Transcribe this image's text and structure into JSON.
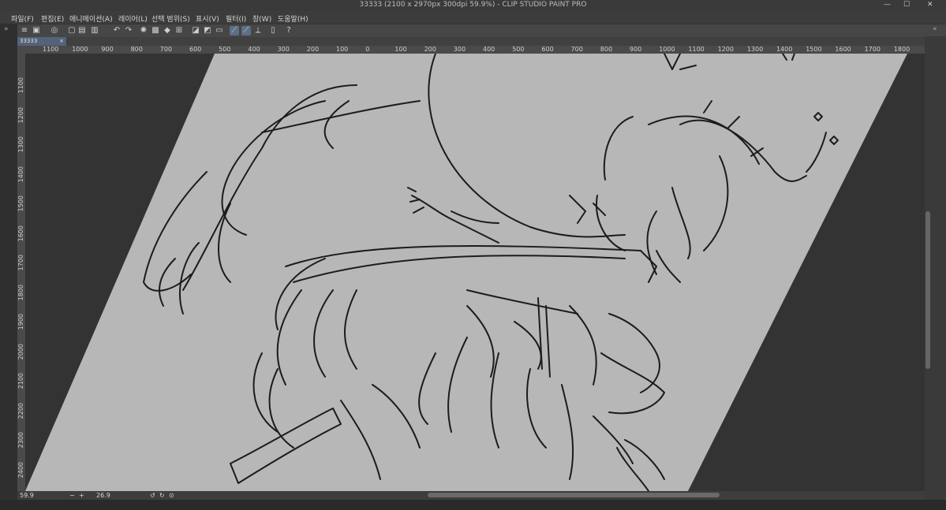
{
  "window": {
    "title": "33333 (2100 x 2970px 300dpi 59.9%)  - CLIP STUDIO PAINT PRO",
    "minimize": "—",
    "maximize": "☐",
    "close": "✕"
  },
  "menu": {
    "items": [
      "파일(F)",
      "편집(E)",
      "애니메이션(A)",
      "레이어(L)",
      "선택 범위(S)",
      "표시(V)",
      "필터(I)",
      "창(W)",
      "도움말(H)"
    ]
  },
  "tabs": {
    "active": "33333",
    "close": "×"
  },
  "ruler": {
    "h_ticks": [
      "1100",
      "1000",
      "900",
      "800",
      "700",
      "600",
      "500",
      "400",
      "300",
      "200",
      "100",
      "0",
      "100",
      "200",
      "300",
      "400",
      "500",
      "600",
      "700",
      "800",
      "900",
      "1000",
      "1100",
      "1200",
      "1300",
      "1400",
      "1500",
      "1600",
      "1700",
      "1800"
    ],
    "v_ticks": [
      "1100",
      "1200",
      "1300",
      "1400",
      "1500",
      "1600",
      "1700",
      "1800",
      "1900",
      "2000",
      "2100",
      "2200",
      "2300",
      "2400"
    ]
  },
  "status": {
    "zoom": "59.9",
    "angle": "26.9",
    "minus": "−",
    "plus": "+"
  },
  "colors": {
    "paper": "#b7b7b7",
    "pasteboard": "#333333",
    "line": "#1c1c1c",
    "accent": "#5e6f86"
  },
  "icons": {
    "menu": "hamburger-icon",
    "undo": "undo-icon",
    "redo": "redo-icon",
    "save": "save-icon"
  }
}
